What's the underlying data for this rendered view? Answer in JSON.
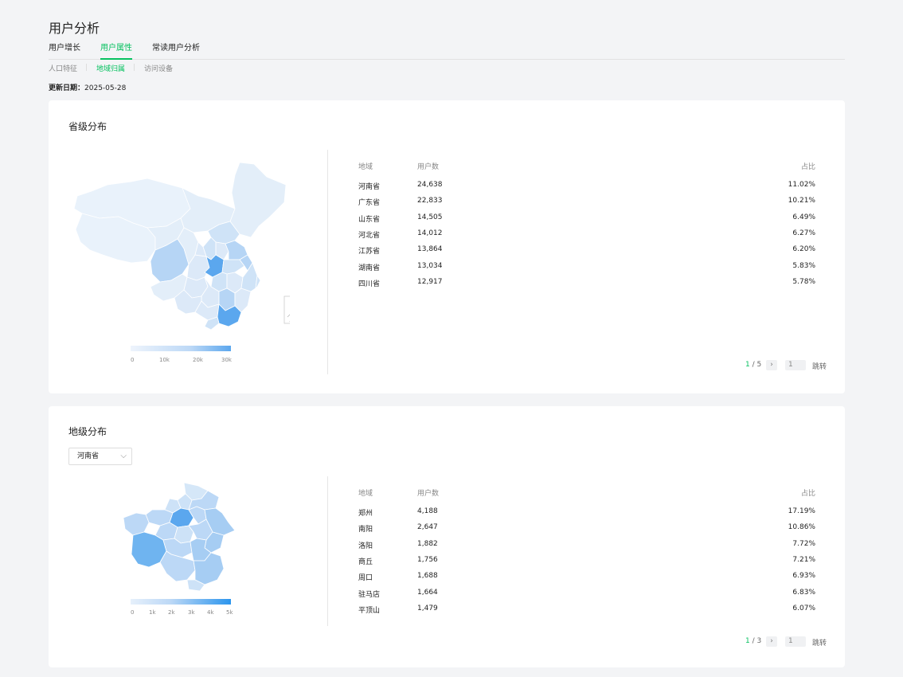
{
  "page_title": "用户分析",
  "tabs": [
    "用户增长",
    "用户属性",
    "常读用户分析"
  ],
  "subtabs": [
    "人口特征",
    "地域归属",
    "访问设备"
  ],
  "update": {
    "label": "更新日期：",
    "date": "2025-05-28"
  },
  "colors": {
    "accent": "#07c160",
    "map_light": "#e3eef9",
    "map_mid": "#a6cdf3",
    "map_dark": "#5ba7ee"
  },
  "province_card": {
    "title": "省级分布",
    "headers": {
      "region": "地域",
      "users": "用户数",
      "ratio": "占比"
    },
    "rows": [
      {
        "region": "河南省",
        "users": "24,638",
        "ratio": "11.02%"
      },
      {
        "region": "广东省",
        "users": "22,833",
        "ratio": "10.21%"
      },
      {
        "region": "山东省",
        "users": "14,505",
        "ratio": "6.49%"
      },
      {
        "region": "河北省",
        "users": "14,012",
        "ratio": "6.27%"
      },
      {
        "region": "江苏省",
        "users": "13,864",
        "ratio": "6.20%"
      },
      {
        "region": "湖南省",
        "users": "13,034",
        "ratio": "5.83%"
      },
      {
        "region": "四川省",
        "users": "12,917",
        "ratio": "5.78%"
      }
    ],
    "legend": [
      "0",
      "10k",
      "20k",
      "30k"
    ],
    "pager": {
      "current": "1",
      "total": "/ 5",
      "next": "›",
      "input": "1",
      "jump": "跳转"
    }
  },
  "city_card": {
    "title": "地级分布",
    "select_value": "河南省",
    "headers": {
      "region": "地域",
      "users": "用户数",
      "ratio": "占比"
    },
    "rows": [
      {
        "region": "郑州",
        "users": "4,188",
        "ratio": "17.19%"
      },
      {
        "region": "南阳",
        "users": "2,647",
        "ratio": "10.86%"
      },
      {
        "region": "洛阳",
        "users": "1,882",
        "ratio": "7.72%"
      },
      {
        "region": "商丘",
        "users": "1,756",
        "ratio": "7.21%"
      },
      {
        "region": "周口",
        "users": "1,688",
        "ratio": "6.93%"
      },
      {
        "region": "驻马店",
        "users": "1,664",
        "ratio": "6.83%"
      },
      {
        "region": "平顶山",
        "users": "1,479",
        "ratio": "6.07%"
      }
    ],
    "legend": [
      "0",
      "1k",
      "2k",
      "3k",
      "4k",
      "5k"
    ],
    "pager": {
      "current": "1",
      "total": "/ 3",
      "next": "›",
      "input": "1",
      "jump": "跳转"
    }
  }
}
